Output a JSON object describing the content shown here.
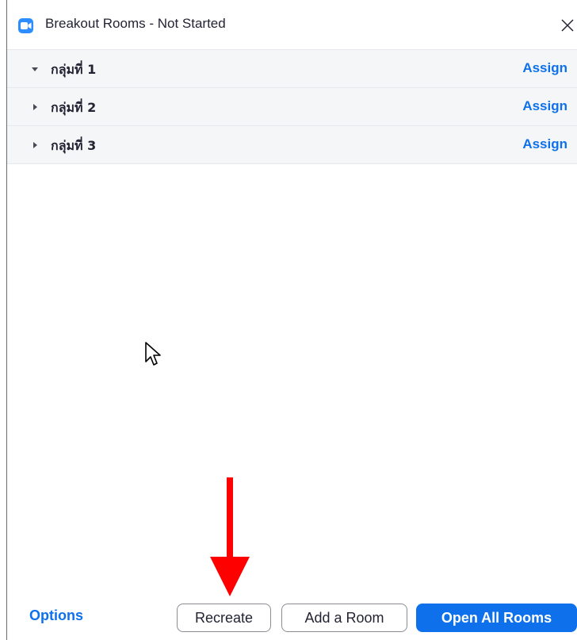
{
  "window": {
    "title": "Breakout Rooms - Not Started",
    "icon": "zoom-camera-icon",
    "close_glyph": "✕"
  },
  "rooms": [
    {
      "name": "กลุ่มที่ 1",
      "expanded": true,
      "action": "Assign"
    },
    {
      "name": "กลุ่มที่ 2",
      "expanded": false,
      "action": "Assign"
    },
    {
      "name": "กลุ่มที่ 3",
      "expanded": false,
      "action": "Assign"
    }
  ],
  "footer": {
    "options_label": "Options",
    "recreate_label": "Recreate",
    "add_room_label": "Add a Room",
    "open_all_label": "Open All Rooms"
  },
  "annotations": {
    "arrow_color": "#ff0000"
  },
  "colors": {
    "accent": "#0e71eb",
    "row_background": "#f5f6f8",
    "text": "#232333"
  }
}
